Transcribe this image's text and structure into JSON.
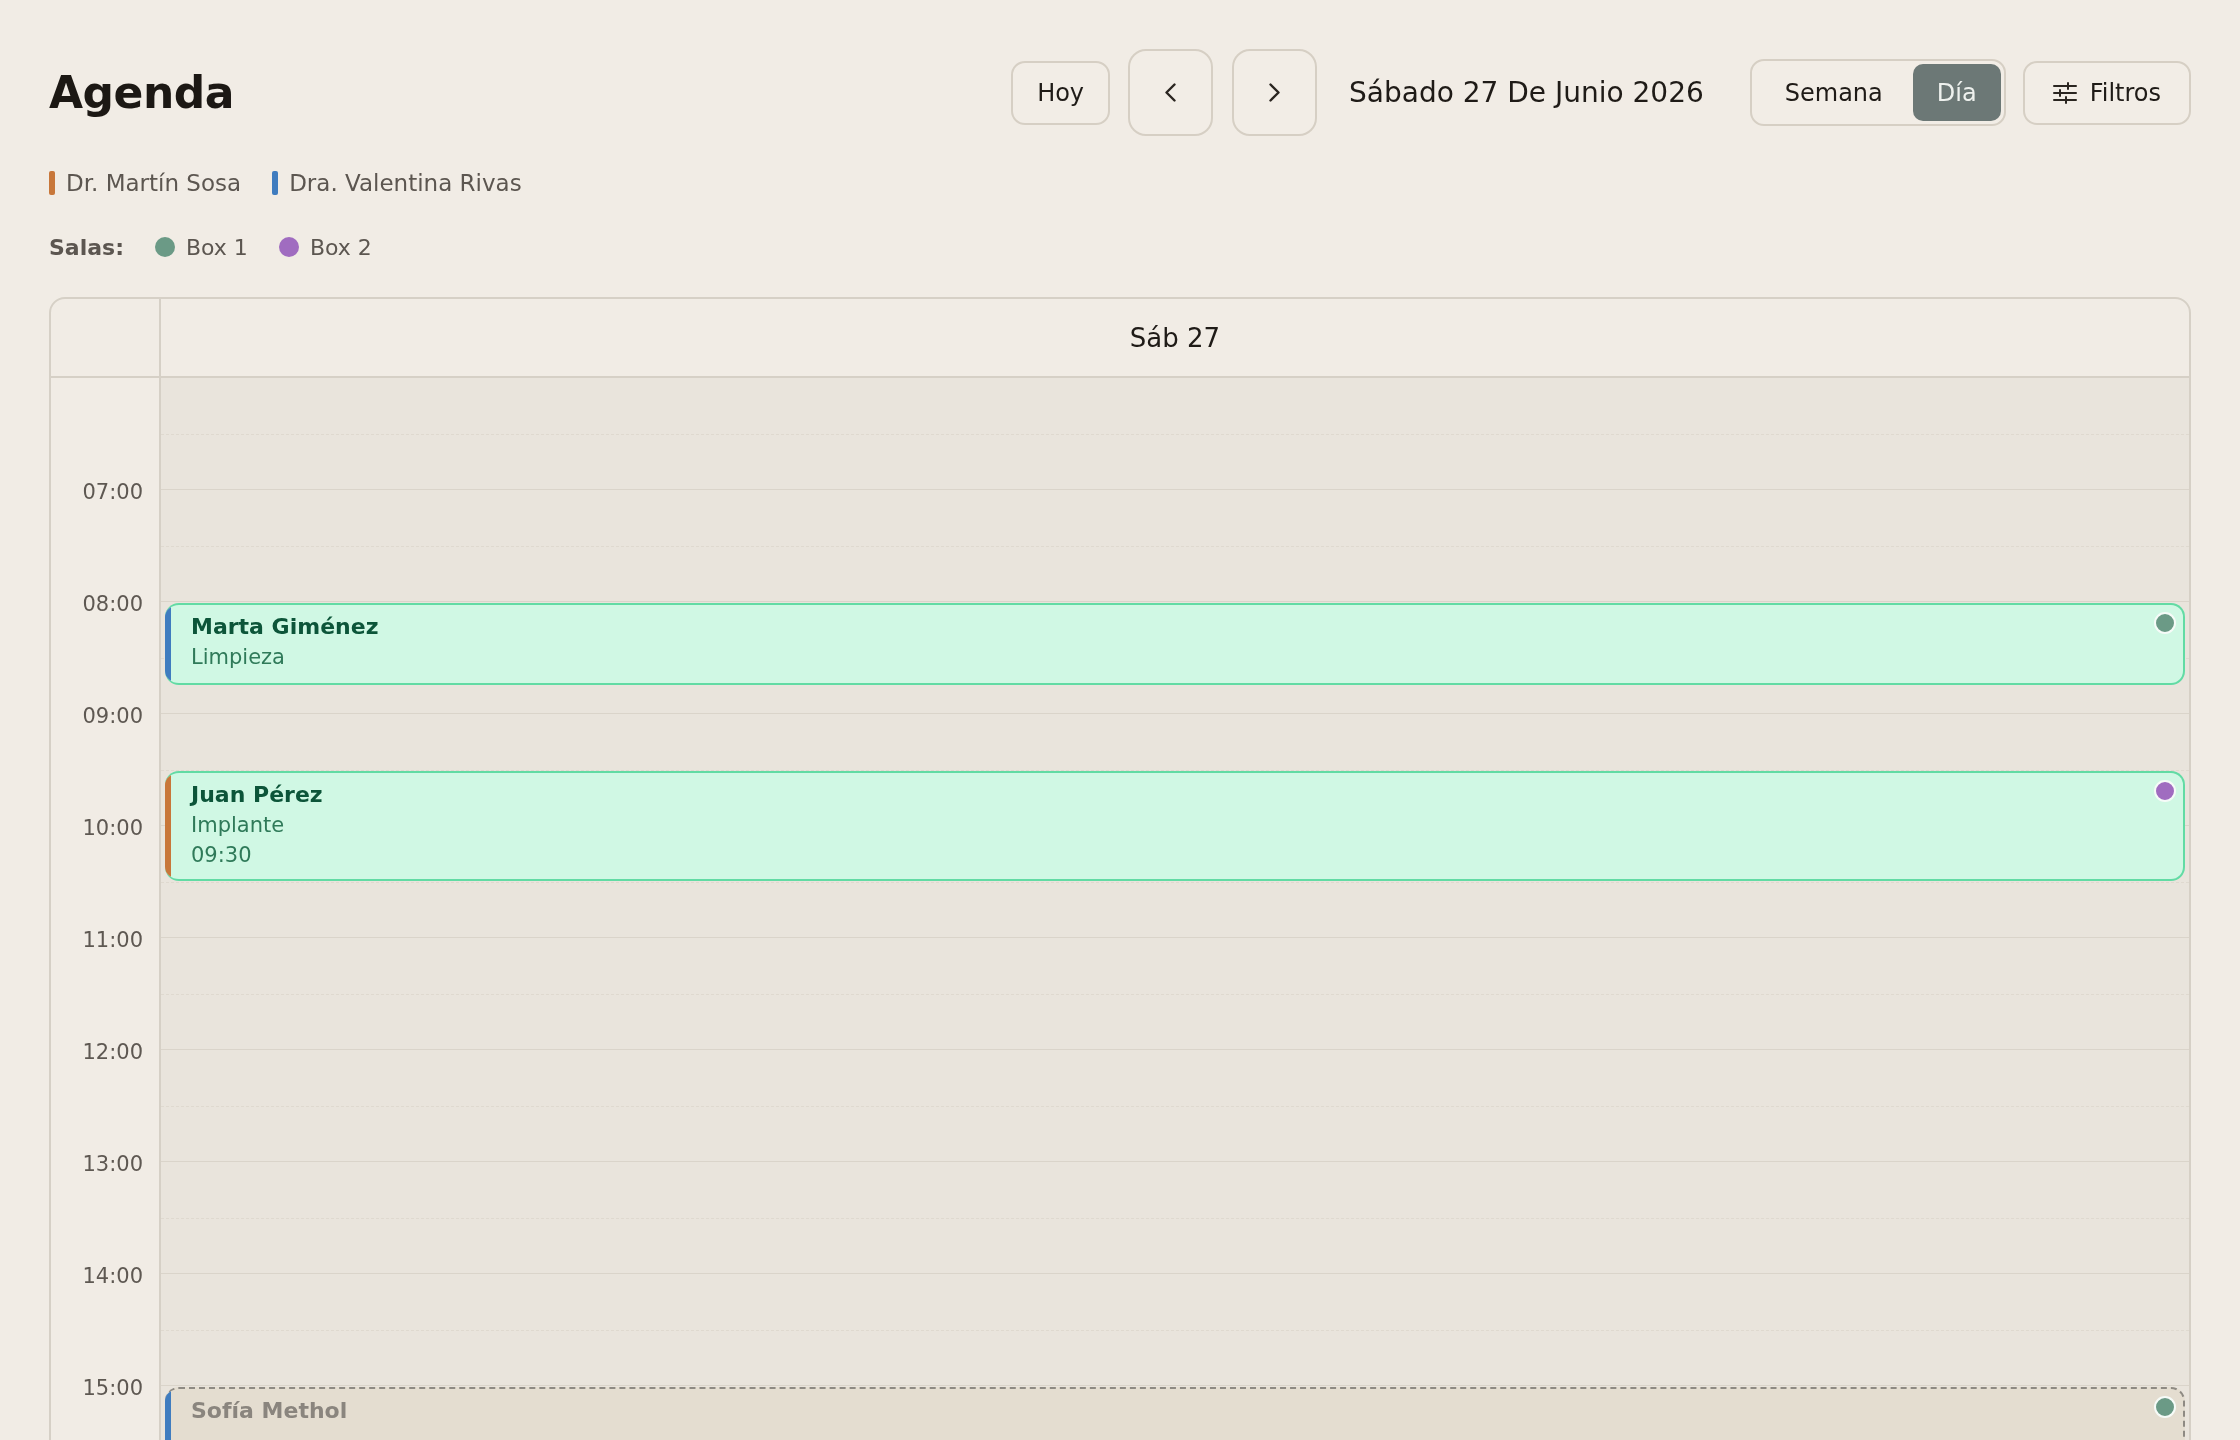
{
  "header": {
    "title": "Agenda",
    "today": "Hoy",
    "date": "Sábado 27 De Junio 2026",
    "views": [
      {
        "label": "Semana",
        "selected": false
      },
      {
        "label": "Día",
        "selected": true
      }
    ],
    "filters": "Filtros"
  },
  "doctors": [
    {
      "name": "Dr. Martín Sosa",
      "color": "#c8773a"
    },
    {
      "name": "Dra. Valentina Rivas",
      "color": "#3f7cbf"
    }
  ],
  "rooms": {
    "label": "Salas:",
    "items": [
      {
        "name": "Box 1",
        "color": "#6b9a86"
      },
      {
        "name": "Box 2",
        "color": "#a06cc0"
      }
    ]
  },
  "calendar": {
    "day": "Sáb 27",
    "hours": [
      "07:00",
      "08:00",
      "09:00",
      "10:00",
      "11:00",
      "12:00",
      "13:00",
      "14:00",
      "15:00"
    ],
    "events": [
      {
        "patient": "Marta Giménez",
        "treatment": "Limpieza",
        "kind": "confirmed",
        "doctor": {
          "color": "#3f7cbf"
        },
        "room": {
          "color": "#6b9a86"
        }
      },
      {
        "patient": "Juan Pérez",
        "treatment": "Implante",
        "time": "09:30",
        "kind": "confirmed",
        "doctor": {
          "color": "#c8773a"
        },
        "room": {
          "color": "#a06cc0"
        }
      },
      {
        "patient": "Sofía Methol",
        "kind": "tentative",
        "doctor": {
          "color": "#3f7cbf"
        },
        "room": {
          "color": "#6b9a86"
        }
      }
    ]
  }
}
